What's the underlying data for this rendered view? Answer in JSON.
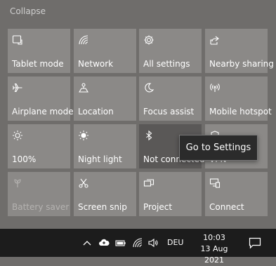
{
  "action_center": {
    "collapse_label": "Collapse",
    "tiles": [
      {
        "label": "Tablet mode",
        "icon": "tablet-mode-icon",
        "state": "off"
      },
      {
        "label": "Network",
        "icon": "network-icon",
        "state": "off"
      },
      {
        "label": "All settings",
        "icon": "gear-icon",
        "state": "off"
      },
      {
        "label": "Nearby sharing",
        "icon": "share-icon",
        "state": "off"
      },
      {
        "label": "Airplane mode",
        "icon": "airplane-icon",
        "state": "off"
      },
      {
        "label": "Location",
        "icon": "location-icon",
        "state": "off"
      },
      {
        "label": "Focus assist",
        "icon": "moon-icon",
        "state": "off"
      },
      {
        "label": "Mobile hotspot",
        "icon": "hotspot-icon",
        "state": "off"
      },
      {
        "label": "100%",
        "icon": "brightness-icon",
        "state": "off"
      },
      {
        "label": "Night light",
        "icon": "night-light-icon",
        "state": "off"
      },
      {
        "label": "Not connected",
        "icon": "bluetooth-icon",
        "state": "hover"
      },
      {
        "label": "VPN",
        "icon": "vpn-icon",
        "state": "off"
      },
      {
        "label": "Battery saver",
        "icon": "battery-saver-icon",
        "state": "disabled"
      },
      {
        "label": "Screen snip",
        "icon": "screen-snip-icon",
        "state": "off"
      },
      {
        "label": "Project",
        "icon": "project-icon",
        "state": "off"
      },
      {
        "label": "Connect",
        "icon": "connect-icon",
        "state": "off"
      }
    ],
    "tooltip": "Go to Settings"
  },
  "taskbar": {
    "language": "DEU",
    "time": "10:03",
    "date": "13 Aug 2021",
    "tray_icons": [
      "chevron-up-icon",
      "onedrive-cloud-icon",
      "battery-icon",
      "wifi-icon",
      "volume-icon"
    ],
    "notification_icon": "action-center-icon"
  },
  "colors": {
    "tile_bg": "#8b8987",
    "panel_bg": "#6f6d6b",
    "taskbar_bg": "#1c1c1c",
    "tooltip_bg": "#2b2b2b"
  }
}
